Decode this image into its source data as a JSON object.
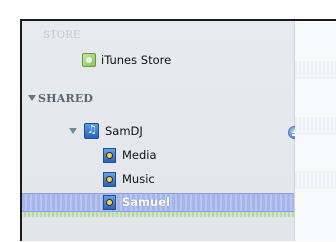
{
  "sidebar": {
    "store_header": "STORE",
    "store_items": [
      {
        "label": "iTunes Store",
        "icon": "itunes-store-icon"
      }
    ],
    "shared_header": "SHARED",
    "shared_library": {
      "label": "SamDJ",
      "icon": "shared-library-icon",
      "eject_icon": "eject-icon",
      "playlists": [
        {
          "label": "Media",
          "icon": "playlist-icon"
        },
        {
          "label": "Music",
          "icon": "playlist-icon"
        },
        {
          "label": "Samuel",
          "icon": "playlist-icon",
          "selected": true
        }
      ]
    }
  },
  "colors": {
    "sidebar_bg": "#e4e8ec",
    "selection": "#aab8ea",
    "header_text": "#5c6670"
  }
}
